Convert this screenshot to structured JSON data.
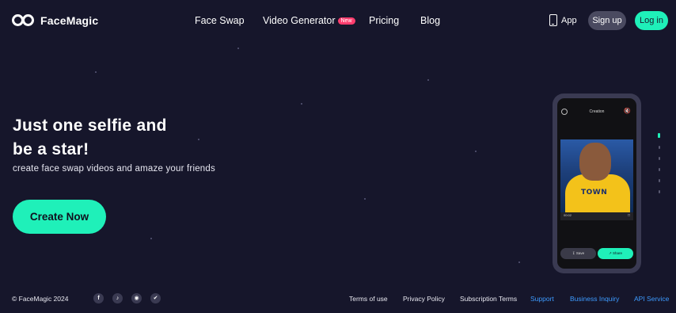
{
  "brand": {
    "name": "FaceMagic"
  },
  "nav": {
    "items": [
      {
        "label": "Face Swap"
      },
      {
        "label": "Video Generator",
        "badge": "New"
      },
      {
        "label": "Pricing"
      },
      {
        "label": "Blog"
      }
    ],
    "app_label": "App",
    "signup_label": "Sign up",
    "login_label": "Log in"
  },
  "hero": {
    "title_line1": "Just one selfie and",
    "title_line2": "be a star!",
    "subtitle": "create face swap videos and amaze your friends",
    "cta_label": "Create Now"
  },
  "phone": {
    "screen_title": "Creation",
    "video_time": "00:02",
    "jersey_text": "TOWN",
    "save_label": "Save",
    "share_label": "Share"
  },
  "pager": {
    "count": 6,
    "active_index": 0
  },
  "footer": {
    "copyright": "© FaceMagic 2024",
    "social_icons": [
      "facebook-icon",
      "tiktok-icon",
      "instagram-icon",
      "twitter-icon"
    ],
    "links": [
      {
        "label": "Terms of use"
      },
      {
        "label": "Privacy Policy"
      },
      {
        "label": "Subscription Terms"
      },
      {
        "label": "Support"
      },
      {
        "label": "Business Inquiry"
      },
      {
        "label": "API Service"
      }
    ]
  },
  "colors": {
    "background": "#16162b",
    "accent": "#1ff0b9",
    "badge": "#ff3d6e",
    "link_blue": "#3d9bff",
    "signup_bg": "#4a4a60"
  }
}
